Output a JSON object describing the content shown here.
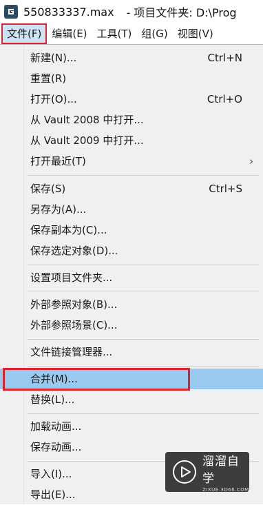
{
  "titlebar": {
    "file_name": "550833337.max",
    "path_text": "- 项目文件夹: D:\\Prog"
  },
  "menubar": {
    "items": [
      "文件(F)",
      "编辑(E)",
      "工具(T)",
      "组(G)",
      "视图(V)"
    ]
  },
  "file_menu": {
    "items": [
      {
        "label": "新建(N)...",
        "shortcut": "Ctrl+N"
      },
      {
        "label": "重置(R)"
      },
      {
        "label": "打开(O)...",
        "shortcut": "Ctrl+O"
      },
      {
        "label": "从 Vault 2008 中打开..."
      },
      {
        "label": "从 Vault 2009 中打开..."
      },
      {
        "label": "打开最近(T)",
        "submenu_arrow": "›"
      },
      {
        "label": "保存(S)",
        "shortcut": "Ctrl+S"
      },
      {
        "label": "另存为(A)..."
      },
      {
        "label": "保存副本为(C)..."
      },
      {
        "label": "保存选定对象(D)..."
      },
      {
        "label": "设置项目文件夹..."
      },
      {
        "label": "外部参照对象(B)..."
      },
      {
        "label": "外部参照场景(C)..."
      },
      {
        "label": "文件链接管理器..."
      },
      {
        "label": "合并(M)...",
        "highlighted": true
      },
      {
        "label": "替换(L)..."
      },
      {
        "label": "加载动画..."
      },
      {
        "label": "保存动画..."
      },
      {
        "label": "导入(I)..."
      },
      {
        "label": "导出(E)..."
      }
    ]
  },
  "watermark": {
    "name": "溜溜自学",
    "url": "ZIXUE.3D66.COM"
  },
  "colors": {
    "highlight": "#99c9ef",
    "annotation_red": "#d9242b",
    "menu_bg": "#f0f0f0"
  }
}
